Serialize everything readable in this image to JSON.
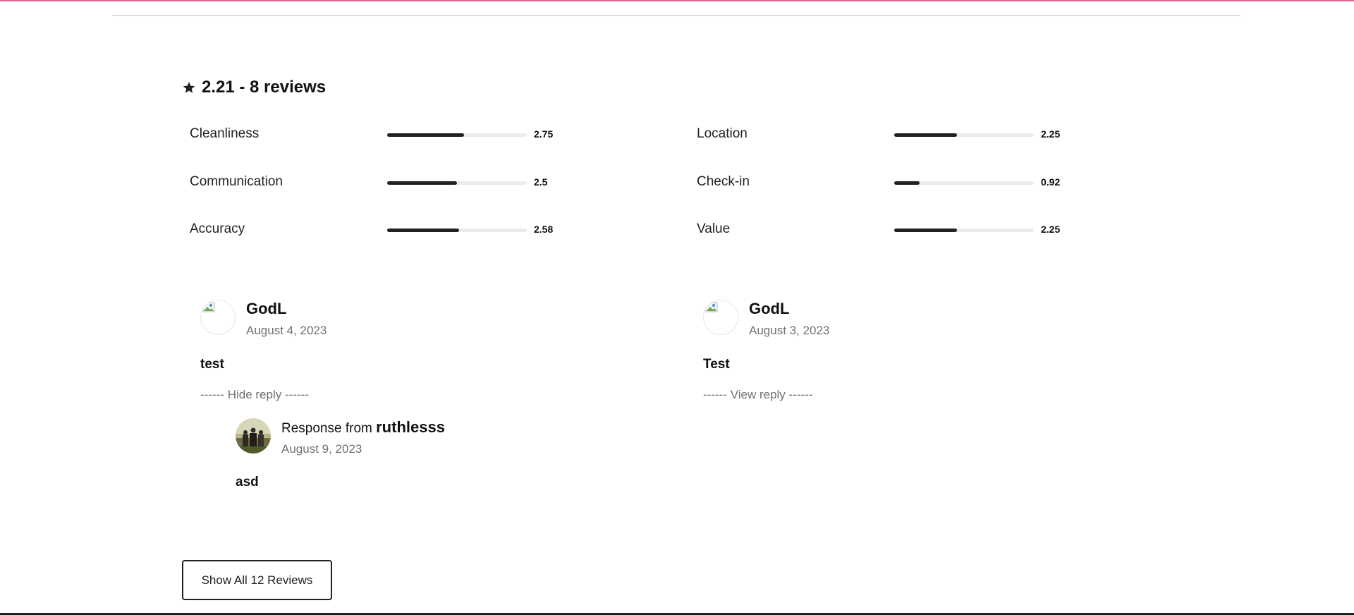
{
  "summary": {
    "icon": "star-icon",
    "text": "2.21 - 8 reviews"
  },
  "ratings": [
    {
      "label": "Cleanliness",
      "value": "2.75",
      "fraction": 0.55
    },
    {
      "label": "Communication",
      "value": "2.5",
      "fraction": 0.5
    },
    {
      "label": "Accuracy",
      "value": "2.58",
      "fraction": 0.516
    },
    {
      "label": "Location",
      "value": "2.25",
      "fraction": 0.45
    },
    {
      "label": "Check-in",
      "value": "0.92",
      "fraction": 0.184
    },
    {
      "label": "Value",
      "value": "2.25",
      "fraction": 0.45
    }
  ],
  "reviews": [
    {
      "name": "GodL",
      "date": "August 4, 2023",
      "text": "test",
      "reply_toggle": "------ Hide reply ------",
      "response": {
        "prefix": "Response from",
        "owner": "ruthlesss",
        "date": "August 9, 2023",
        "text": "asd"
      }
    },
    {
      "name": "GodL",
      "date": "August 3, 2023",
      "text": "Test",
      "reply_toggle": "------ View reply ------"
    }
  ],
  "show_all_label": "Show All 12 Reviews",
  "colors": {
    "accent": "#e0678f",
    "bar_fill": "#222222",
    "bar_track": "#ebebeb",
    "muted_text": "#717171"
  }
}
